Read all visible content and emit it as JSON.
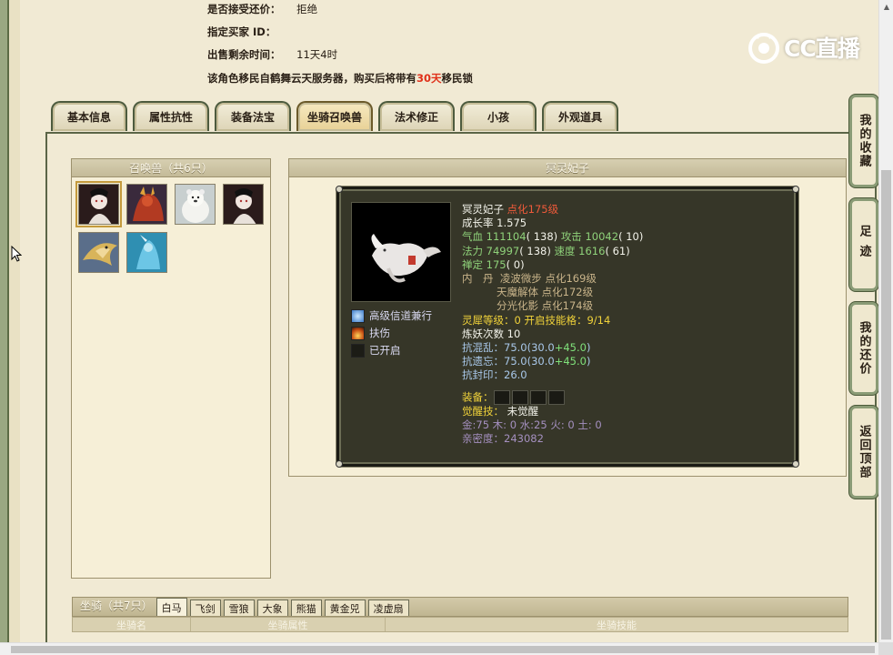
{
  "trade_info": {
    "accept_counter_label": "是否接受还价：",
    "accept_counter_value": "拒绝",
    "buyer_id_label": "指定买家 ID：",
    "buyer_id_value": "",
    "time_left_label": "出售剩余时间：",
    "time_left_value": "11天4时",
    "notice_prefix": "该角色移民自鹤舞云天服务器，购买后将带有",
    "notice_highlight": "30天",
    "notice_suffix": "移民锁"
  },
  "logo": {
    "text": "CC直播"
  },
  "tabs": [
    {
      "label": "基本信息"
    },
    {
      "label": "属性抗性"
    },
    {
      "label": "装备法宝"
    },
    {
      "label": "坐骑召唤兽"
    },
    {
      "label": "法术修正"
    },
    {
      "label": "小孩"
    },
    {
      "label": "外观道具"
    }
  ],
  "active_tab": "坐骑召唤兽",
  "summon_panel": {
    "title": "召唤兽（共6只）",
    "pets": [
      {
        "icon": "white-fox-lady-portrait"
      },
      {
        "icon": "red-demon-portrait"
      },
      {
        "icon": "white-bear-portrait"
      },
      {
        "icon": "white-fox-lady-portrait"
      },
      {
        "icon": "golden-phoenix-portrait"
      },
      {
        "icon": "blue-spirit-portrait"
      }
    ]
  },
  "detail": {
    "title": "冥灵妃子",
    "name": "冥灵妃子",
    "level": "点化175级",
    "growth_label": "成长率",
    "growth": "1.575",
    "hp_label": "气血",
    "hp": "111104",
    "hp_extra": "( 138)",
    "atk_label": "攻击",
    "atk": "10042",
    "atk_extra": "( 10)",
    "mp_label": "法力",
    "mp": "74997",
    "mp_extra": "( 138)",
    "spd_label": "速度",
    "spd": "1616",
    "spd_extra": "( 61)",
    "calm_label": "禅定",
    "calm": "175",
    "calm_extra": "( 0)",
    "neidan_label": "内　丹",
    "neidan": [
      {
        "name": "凌波微步",
        "level": "点化169级"
      },
      {
        "name": "天魔解体",
        "level": "点化172级"
      },
      {
        "name": "分光化影",
        "level": "点化174级"
      }
    ],
    "lingxi_label": "灵犀等级：",
    "lingxi": "0",
    "skill_slots_label": "开启技能格：",
    "skill_slots": "9/14",
    "refine_label": "炼妖次数",
    "refine": "10",
    "res_chaos_label": "抗混乱：",
    "res_chaos": "75.0",
    "res_chaos_base": "(30.0",
    "res_chaos_bonus": "+45.0",
    "res_chaos_close": ")",
    "res_forget_label": "抗遗忘：",
    "res_forget": "75.0",
    "res_forget_base": "(30.0",
    "res_forget_bonus": "+45.0",
    "res_forget_close": ")",
    "res_seal_label": "抗封印：",
    "res_seal": "26.0",
    "equip_label": "装备：",
    "awaken_label": "觉醒技：",
    "awaken": "未觉醒",
    "elements": "金:75 木: 0 水:25 火: 0 土: 0",
    "intimacy_label": "亲密度：",
    "intimacy": "243082",
    "skills": [
      {
        "name": "高级信道兼行",
        "icon": "feather-skill-icon"
      },
      {
        "name": "扶伤",
        "icon": "flame-skill-icon"
      },
      {
        "name": "已开启",
        "icon": "dark-slot-icon"
      }
    ]
  },
  "side_buttons": [
    {
      "label": "我的收藏"
    },
    {
      "label": "足迹"
    },
    {
      "label": "我的还价"
    },
    {
      "label": "返回顶部"
    }
  ],
  "mounts": {
    "label": "坐骑（共7只）",
    "tabs": [
      "白马",
      "飞剑",
      "雪狼",
      "大象",
      "熊猫",
      "黄金兕",
      "凌虚扇"
    ],
    "columns": [
      "坐骑名",
      "坐骑属性",
      "坐骑技能"
    ]
  },
  "colors": {
    "highlight": "#e03019",
    "frame": "#5b6547",
    "panel_bg": "#363628"
  }
}
